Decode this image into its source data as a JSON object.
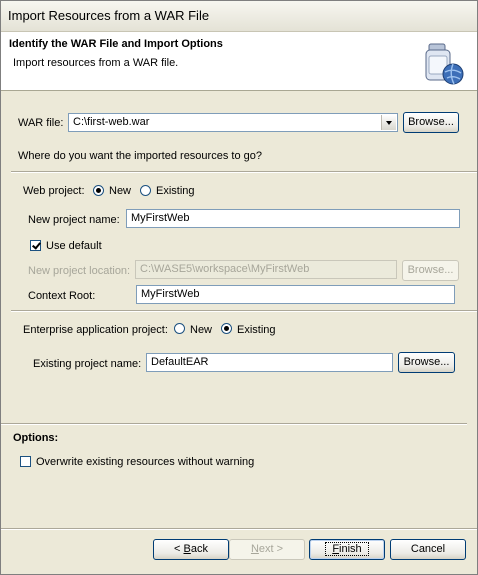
{
  "window": {
    "title": "Import Resources from a WAR File"
  },
  "banner": {
    "title": "Identify the WAR File and Import Options",
    "subtitle": "Import resources from a WAR file.",
    "icon": "jar-globe-icon"
  },
  "war_file": {
    "label": "WAR file:",
    "value": "C:\\first-web.war",
    "browse_label": "Browse..."
  },
  "question": "Where do you want the imported resources to go?",
  "web_project": {
    "label": "Web project:",
    "options": [
      "New",
      "Existing"
    ],
    "selected": "New",
    "name_label": "New project name:",
    "name_value": "MyFirstWeb",
    "use_default_label": "Use default",
    "use_default_checked": true,
    "location_label": "New project location:",
    "location_value": "C:\\WASE5\\workspace\\MyFirstWeb",
    "location_browse_label": "Browse...",
    "context_root_label": "Context Root:",
    "context_root_value": "MyFirstWeb"
  },
  "enterprise_project": {
    "label": "Enterprise application project:",
    "options": [
      "New",
      "Existing"
    ],
    "selected": "Existing",
    "existing_label": "Existing project name:",
    "existing_value": "DefaultEAR",
    "browse_label": "Browse..."
  },
  "options": {
    "heading": "Options:",
    "overwrite_label": "Overwrite existing resources without warning",
    "overwrite_checked": false
  },
  "footer": {
    "back_prefix": "< ",
    "back_mnemonic": "B",
    "back_rest": "ack",
    "next_mnemonic": "N",
    "next_rest": "ext >",
    "finish_mnemonic": "F",
    "finish_rest": "inish",
    "cancel_label": "Cancel"
  }
}
